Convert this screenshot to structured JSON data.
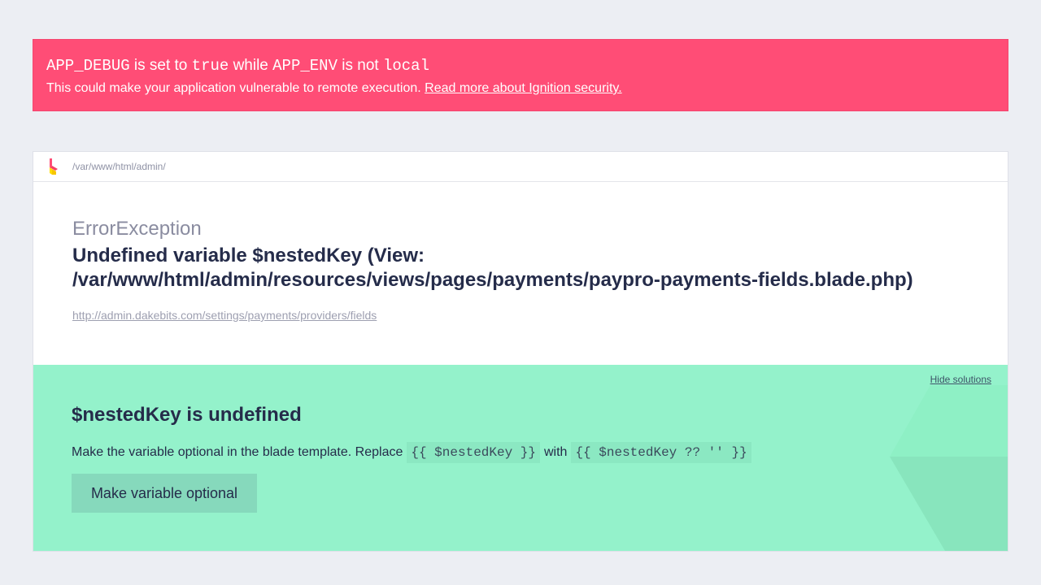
{
  "warning": {
    "debug_var": "APP_DEBUG",
    "is_set_to": "is set to",
    "true_value": "true",
    "while": "while",
    "env_var": "APP_ENV",
    "is_not": "is not",
    "local_value": "local",
    "description": "This could make your application vulnerable to remote execution.",
    "link_text": "Read more about Ignition security."
  },
  "header": {
    "path": "/var/www/html/admin/",
    "logo_icon": "ignition-logo-icon"
  },
  "exception": {
    "class": "ErrorException",
    "message_line1": "Undefined variable $nestedKey (View:",
    "message_line2": "/var/www/html/admin/resources/views/pages/payments/paypro-payments-fields.blade.php)",
    "url": "http://admin.dakebits.com/settings/payments/providers/fields"
  },
  "solution": {
    "hide_label": "Hide solutions",
    "title": "$nestedKey is undefined",
    "desc_prefix": "Make the variable optional in the blade template. Replace",
    "code_before": "{{ $nestedKey }}",
    "with_word": "with",
    "code_after": "{{ $nestedKey ?? '' }}",
    "button_label": "Make variable optional"
  },
  "colors": {
    "warning_bg": "#ff4d76",
    "solution_bg": "#94f2cb",
    "button_bg": "#86d9bc",
    "page_bg": "#eceef3"
  }
}
